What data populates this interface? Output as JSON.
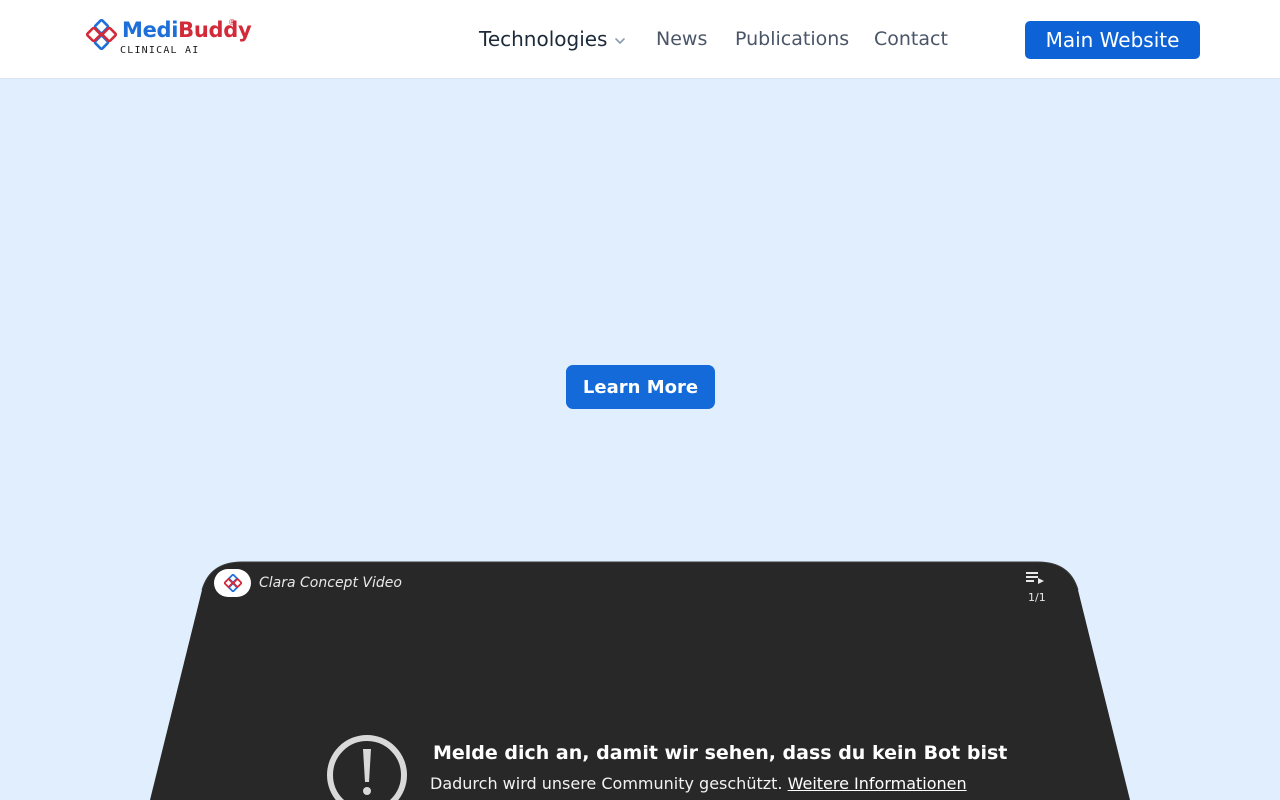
{
  "brand": {
    "name_part1": "Medi",
    "name_part2": "Buddy",
    "registered": "®",
    "tagline": "CLINICAL AI",
    "colors": {
      "blue": "#1f6fd8",
      "red": "#d32a3a"
    }
  },
  "nav": {
    "items": [
      {
        "label": "Technologies",
        "has_dropdown": true
      },
      {
        "label": "News"
      },
      {
        "label": "Publications"
      },
      {
        "label": "Contact"
      }
    ],
    "cta_label": "Main Website"
  },
  "hero": {
    "cta_label": "Learn More"
  },
  "video": {
    "title": "Clara Concept Video",
    "playlist_count": "1/1",
    "message_heading": "Melde dich an, damit wir sehen, dass du kein Bot bist",
    "message_body": "Dadurch wird unsere Community geschützt.",
    "message_link": "Weitere Informationen"
  },
  "colors": {
    "page_bg": "#e1eefe",
    "primary": "#0d63d6",
    "video_bg": "#282828"
  }
}
